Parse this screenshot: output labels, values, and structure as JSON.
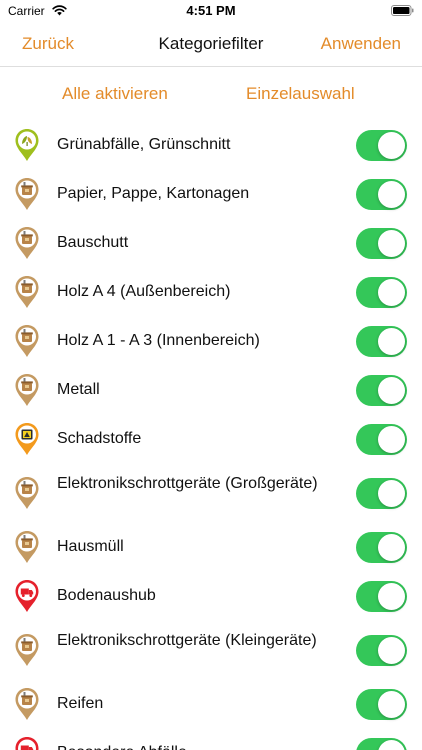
{
  "status_bar": {
    "carrier": "Carrier",
    "time": "4:51 PM"
  },
  "nav": {
    "back_label": "Zurück",
    "title": "Kategoriefilter",
    "apply_label": "Anwenden"
  },
  "actions": {
    "all_label": "Alle aktivieren",
    "single_label": "Einzelauswahl"
  },
  "colors": {
    "accent": "#e38b2a",
    "toggle_on": "#34c759"
  },
  "categories": [
    {
      "label": "Grünabfälle, Grünschnitt",
      "icon": "green-waste-pin-icon",
      "enabled": true
    },
    {
      "label": "Papier, Pappe, Kartonagen",
      "icon": "container-pin-icon",
      "enabled": true
    },
    {
      "label": "Bauschutt",
      "icon": "container-pin-icon",
      "enabled": true
    },
    {
      "label": "Holz A 4 (Außenbereich)",
      "icon": "container-pin-icon",
      "enabled": true
    },
    {
      "label": "Holz A 1 - A 3 (Innenbereich)",
      "icon": "container-pin-icon",
      "enabled": true
    },
    {
      "label": "Metall",
      "icon": "container-pin-icon",
      "enabled": true
    },
    {
      "label": "Schadstoffe",
      "icon": "hazardous-pin-icon",
      "enabled": true
    },
    {
      "label": "Elektronikschrottgeräte (Großgeräte)",
      "icon": "container-pin-icon",
      "enabled": true
    },
    {
      "label": "Hausmüll",
      "icon": "container-pin-icon",
      "enabled": true
    },
    {
      "label": "Bodenaushub",
      "icon": "truck-pin-icon",
      "enabled": true
    },
    {
      "label": "Elektronikschrottgeräte (Kleingeräte)",
      "icon": "container-pin-icon",
      "enabled": true
    },
    {
      "label": "Reifen",
      "icon": "container-pin-icon",
      "enabled": true
    },
    {
      "label": "Besondere Abfälle",
      "icon": "truck-pin-icon",
      "enabled": true
    }
  ]
}
